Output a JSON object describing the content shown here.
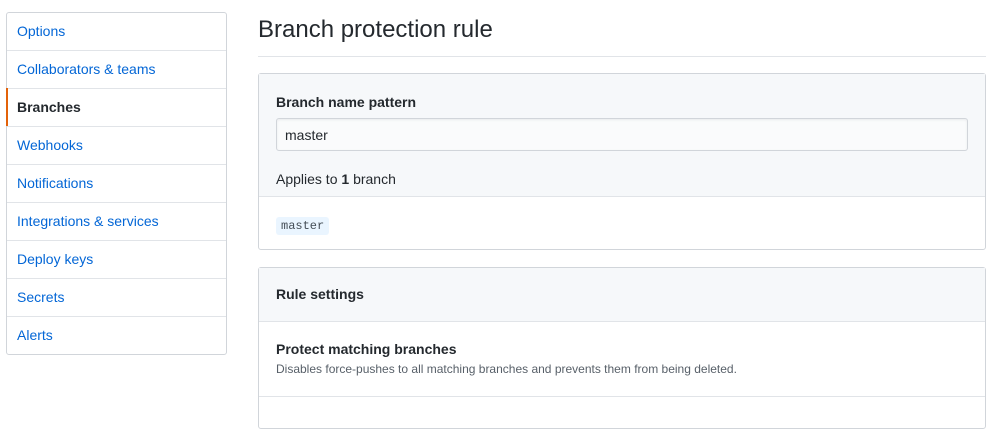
{
  "sidebar": {
    "items": [
      {
        "label": "Options"
      },
      {
        "label": "Collaborators & teams"
      },
      {
        "label": "Branches"
      },
      {
        "label": "Webhooks"
      },
      {
        "label": "Notifications"
      },
      {
        "label": "Integrations & services"
      },
      {
        "label": "Deploy keys"
      },
      {
        "label": "Secrets"
      },
      {
        "label": "Alerts"
      }
    ],
    "selected": "Branches",
    "accent_color": "#e36209",
    "link_color": "#0366d6"
  },
  "main": {
    "title": "Branch protection rule",
    "pattern": {
      "label": "Branch name pattern",
      "value": "master",
      "applies_prefix": "Applies to",
      "applies_count": "1",
      "applies_suffix": "branch",
      "matched_branches": [
        "master"
      ]
    },
    "rules": {
      "header": "Rule settings",
      "items": [
        {
          "title": "Protect matching branches",
          "description": "Disables force-pushes to all matching branches and prevents them from being deleted."
        }
      ]
    }
  }
}
